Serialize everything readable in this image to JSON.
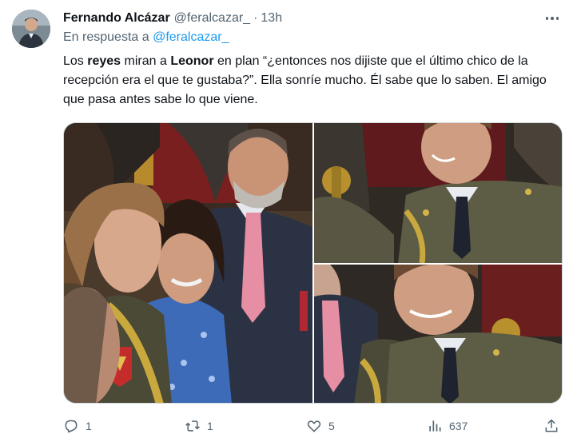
{
  "tweet": {
    "author_name": "Fernando Alcázar",
    "author_handle": "@feralcazar_",
    "separator": "·",
    "timestamp": "13h",
    "reply_prefix": "En respuesta a",
    "reply_mention": "@feralcazar_",
    "text_segments": [
      {
        "text": "Los ",
        "bold": false
      },
      {
        "text": "reyes",
        "bold": true
      },
      {
        "text": " miran a ",
        "bold": false
      },
      {
        "text": "Leonor",
        "bold": true
      },
      {
        "text": " en plan “¿entonces nos dijiste que el último chico de la recepción era el que te gustaba?”. Ella sonríe mucho. Él sabe que lo saben. El amigo que pasa antes sabe lo que viene.",
        "bold": false
      }
    ]
  },
  "media": {
    "photos": [
      {
        "id": "main",
        "icon": "photo-royals-at-reception"
      },
      {
        "id": "top-right",
        "icon": "photo-cadet-smiling"
      },
      {
        "id": "bottom-right",
        "icon": "photo-cadet-laughing"
      }
    ]
  },
  "actions": {
    "reply_count": "1",
    "retweet_count": "1",
    "like_count": "5",
    "views_count": "637",
    "icons": [
      "reply-icon",
      "retweet-icon",
      "like-icon",
      "views-icon",
      "share-icon"
    ]
  },
  "colors": {
    "text_primary": "#0f1419",
    "text_secondary": "#536471",
    "link": "#1d9bf0",
    "border": "#cfd9de"
  }
}
